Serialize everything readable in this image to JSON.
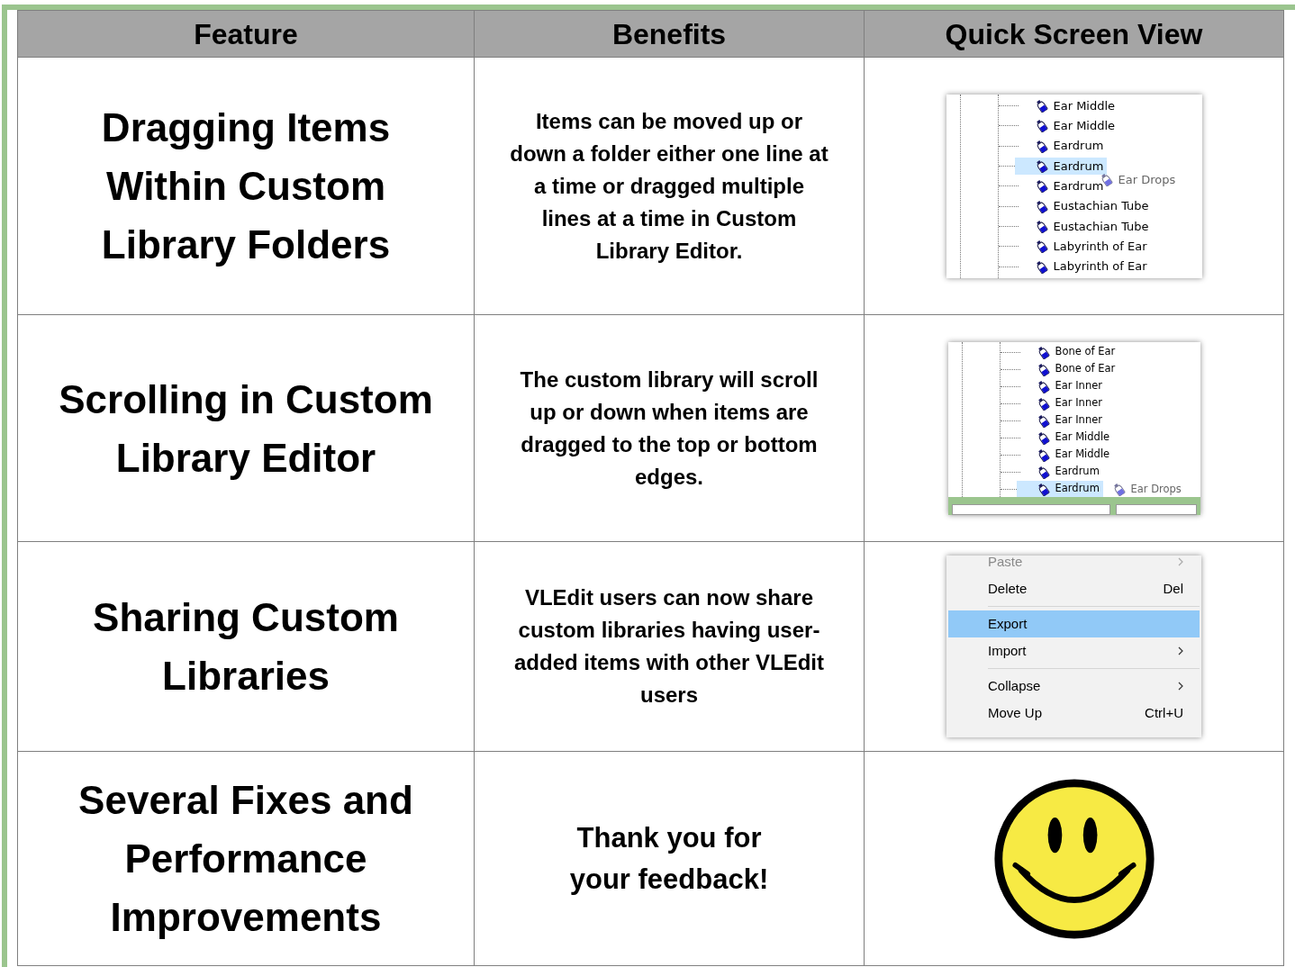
{
  "table": {
    "columns": [
      "Feature",
      "Benefits",
      "Quick Screen View"
    ],
    "rows": [
      {
        "feature": "Dragging Items Within Custom Library Folders",
        "benefits": "Items can be moved up or down a folder either one line at a time or dragged multiple lines at a time in Custom Library Editor.",
        "view": {
          "kind": "tree",
          "drag_label": "Ear Drops",
          "items": [
            {
              "label": "Ear Middle",
              "selected": false
            },
            {
              "label": "Ear Middle",
              "selected": false
            },
            {
              "label": "Eardrum",
              "selected": false
            },
            {
              "label": "Eardrum",
              "selected": true
            },
            {
              "label": "Eardrum",
              "selected": false
            },
            {
              "label": "Eustachian Tube",
              "selected": false
            },
            {
              "label": "Eustachian Tube",
              "selected": false
            },
            {
              "label": "Labyrinth of Ear",
              "selected": false
            },
            {
              "label": "Labyrinth of Ear",
              "selected": false
            }
          ]
        }
      },
      {
        "feature": "Scrolling in Custom Library Editor",
        "benefits": "The custom library will scroll up or down when items are dragged to the top or bottom edges.",
        "view": {
          "kind": "scroll_tree",
          "drag_label": "Ear Drops",
          "items": [
            {
              "label": "Bone of Ear",
              "selected": false
            },
            {
              "label": "Bone of Ear",
              "selected": false
            },
            {
              "label": "Ear Inner",
              "selected": false
            },
            {
              "label": "Ear Inner",
              "selected": false
            },
            {
              "label": "Ear Inner",
              "selected": false
            },
            {
              "label": "Ear Middle",
              "selected": false
            },
            {
              "label": "Ear Middle",
              "selected": false
            },
            {
              "label": "Eardrum",
              "selected": false
            },
            {
              "label": "Eardrum",
              "selected": true
            }
          ]
        }
      },
      {
        "feature": "Sharing Custom Libraries",
        "benefits": "VLEdit users can now share custom libraries having user-added items with other VLEdit users",
        "view": {
          "kind": "menu",
          "items": [
            {
              "label": "Paste",
              "disabled": true,
              "selected": false,
              "submenu": true,
              "separator_before": false
            },
            {
              "label": "Delete",
              "shortcut": "Del",
              "disabled": false,
              "selected": false,
              "submenu": false,
              "separator_before": false
            },
            {
              "label": "Export",
              "disabled": false,
              "selected": true,
              "submenu": false,
              "separator_before": true
            },
            {
              "label": "Import",
              "disabled": false,
              "selected": false,
              "submenu": true,
              "separator_before": false
            },
            {
              "label": "Collapse",
              "disabled": false,
              "selected": false,
              "submenu": true,
              "separator_before": true
            },
            {
              "label": "Move Up",
              "shortcut": "Ctrl+U",
              "disabled": false,
              "selected": false,
              "submenu": false,
              "separator_before": false
            }
          ]
        }
      },
      {
        "feature": "Several Fixes and Performance Improvements",
        "benefits": "Thank you for your feedback!",
        "view": {
          "kind": "smiley"
        }
      }
    ]
  }
}
